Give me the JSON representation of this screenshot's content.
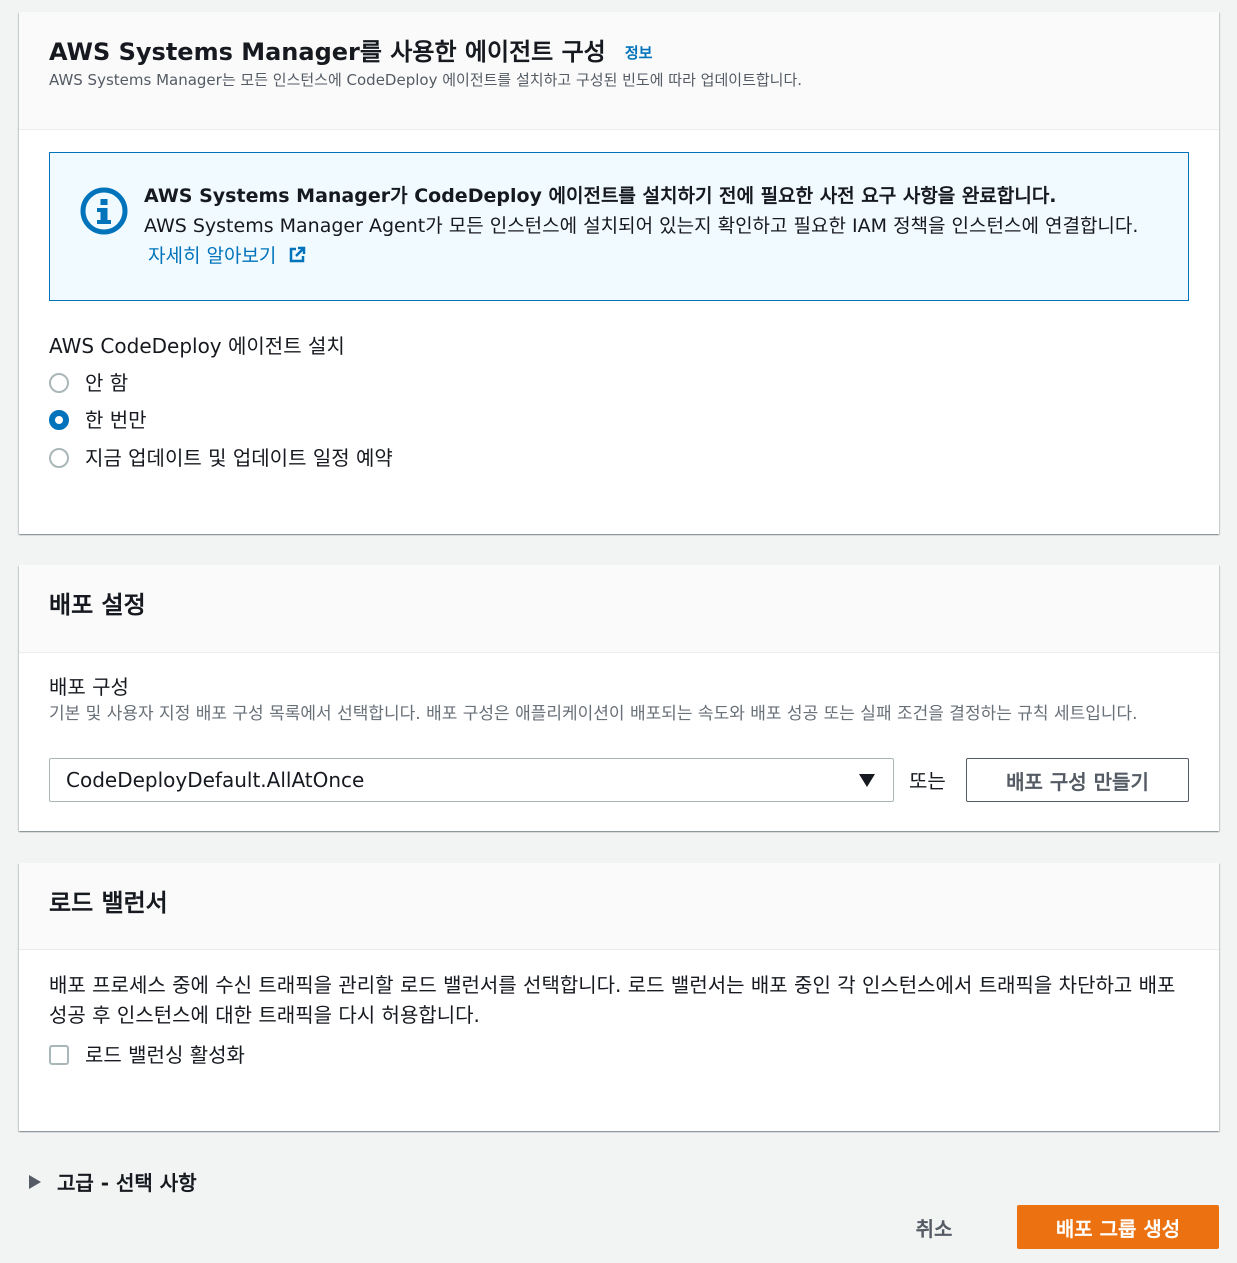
{
  "ssm_panel": {
    "title": "AWS Systems Manager를 사용한 에이전트 구성",
    "info_link": "정보",
    "description": "AWS Systems Manager는 모든 인스턴스에 CodeDeploy 에이전트를 설치하고 구성된 빈도에 따라 업데이트합니다.",
    "alert": {
      "title": "AWS Systems Manager가 CodeDeploy 에이전트를 설치하기 전에 필요한 사전 요구 사항을 완료합니다.",
      "body": "AWS Systems Manager Agent가 모든 인스턴스에 설치되어 있는지 확인하고 필요한 IAM 정책을 인스턴스에 연결합니다.",
      "link": "자세히 알아보기"
    },
    "install_label": "AWS CodeDeploy 에이전트 설치",
    "options": [
      "안 함",
      "한 번만",
      "지금 업데이트 및 업데이트 일정 예약"
    ],
    "selected_index": 1
  },
  "deploy_settings": {
    "title": "배포 설정",
    "config_label": "배포 구성",
    "config_description": "기본 및 사용자 지정 배포 구성 목록에서 선택합니다. 배포 구성은 애플리케이션이 배포되는 속도와 배포 성공 또는 실패 조건을 결정하는 규칙 세트입니다.",
    "selected_config": "CodeDeployDefault.AllAtOnce",
    "or_text": "또는",
    "create_button": "배포 구성 만들기"
  },
  "load_balancer": {
    "title": "로드 밸런서",
    "description": "배포 프로세스 중에 수신 트래픽을 관리할 로드 밸런서를 선택합니다. 로드 밸런서는 배포 중인 각 인스턴스에서 트래픽을 차단하고 배포 성공 후 인스턴스에 대한 트래픽을 다시 허용합니다.",
    "checkbox_label": "로드 밸런싱 활성화"
  },
  "advanced": {
    "label": "고급 - 선택 사항"
  },
  "footer": {
    "cancel": "취소",
    "submit": "배포 그룹 생성"
  },
  "colors": {
    "accent": "#0073bb",
    "primary_button": "#ec7211",
    "background": "#f2f3f3"
  },
  "icons": {
    "alert": "info-circle-icon",
    "external": "external-link-icon",
    "caret": "caret-down-icon",
    "expand": "caret-right-icon"
  }
}
